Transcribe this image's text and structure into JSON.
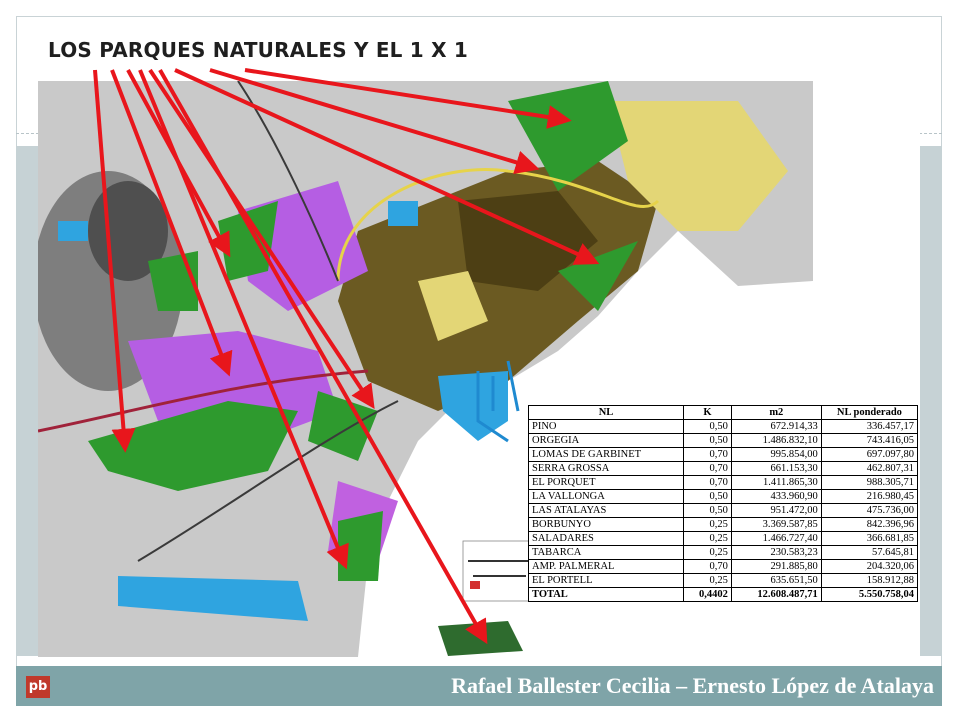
{
  "slide": {
    "title": "LOS PARQUES NATURALES Y EL 1 X 1",
    "logo_text": "pb",
    "footer": "Rafael Ballester Cecilia – Ernesto López de Atalaya"
  },
  "colors": {
    "arrow": "#e8161c",
    "park_green": "#2e9a2e",
    "urban_brown": "#5a4a1a",
    "purple": "#b45ce6",
    "yellow": "#e6d977",
    "blue": "#2fa4e0",
    "footer": "#7fa4a8"
  },
  "table": {
    "headers": [
      "NL",
      "K",
      "m2",
      "NL ponderado"
    ],
    "rows": [
      [
        "PINO",
        "0,50",
        "672.914,33",
        "336.457,17"
      ],
      [
        "ORGEGIA",
        "0,50",
        "1.486.832,10",
        "743.416,05"
      ],
      [
        "LOMAS DE GARBINET",
        "0,70",
        "995.854,00",
        "697.097,80"
      ],
      [
        "SERRA GROSSA",
        "0,70",
        "661.153,30",
        "462.807,31"
      ],
      [
        "EL PORQUET",
        "0,70",
        "1.411.865,30",
        "988.305,71"
      ],
      [
        "LA VALLONGA",
        "0,50",
        "433.960,90",
        "216.980,45"
      ],
      [
        "LAS ATALAYAS",
        "0,50",
        "951.472,00",
        "475.736,00"
      ],
      [
        "BORBUNYO",
        "0,25",
        "3.369.587,85",
        "842.396,96"
      ],
      [
        "SALADARES",
        "0,25",
        "1.466.727,40",
        "366.681,85"
      ],
      [
        "TABARCA",
        "0,25",
        "230.583,23",
        "57.645,81"
      ],
      [
        "AMP. PALMERAL",
        "0,70",
        "291.885,80",
        "204.320,06"
      ],
      [
        "EL PORTELL",
        "0,25",
        "635.651,50",
        "158.912,88"
      ]
    ],
    "total": [
      "TOTAL",
      "0,4402",
      "12.608.487,71",
      "5.550.758,04"
    ]
  }
}
